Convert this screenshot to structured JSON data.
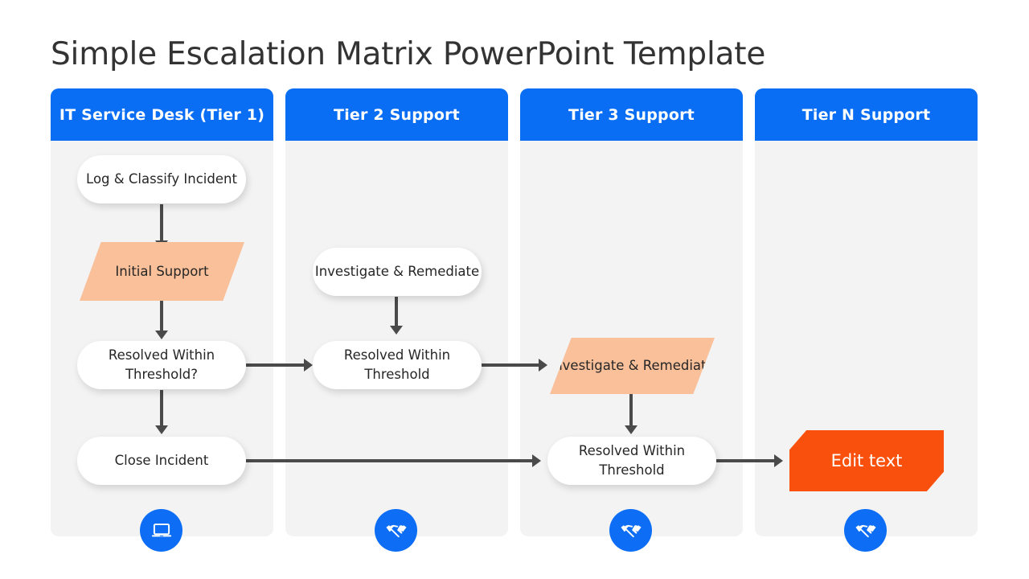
{
  "slide": {
    "title": "Simple Escalation Matrix PowerPoint Template",
    "background": "#ffffff"
  },
  "colors": {
    "header_blue": "#0a6ef5",
    "panel_gray": "#f3f3f3",
    "parallelogram_peach": "#f9c09a",
    "hexagon_orange": "#f9510d",
    "arrow_gray": "#4a4a4a",
    "node_white": "#ffffff",
    "text_dark": "#262626",
    "title_gray": "#333333"
  },
  "columns": [
    {
      "header": "IT Service Desk (Tier 1)",
      "icon": "laptop-icon",
      "nodes": [
        {
          "label": "Log & Classify Incident",
          "shape": "pill"
        },
        {
          "label": "Initial Support",
          "shape": "parallelogram"
        },
        {
          "label": "Resolved Within Threshold?",
          "shape": "pill"
        },
        {
          "label": "Close Incident",
          "shape": "pill"
        }
      ]
    },
    {
      "header": "Tier 2 Support",
      "icon": "handshake-icon",
      "nodes": [
        {
          "label": "Investigate & Remediate",
          "shape": "pill"
        },
        {
          "label": "Resolved Within Threshold",
          "shape": "pill"
        }
      ]
    },
    {
      "header": "Tier 3 Support",
      "icon": "handshake-icon",
      "nodes": [
        {
          "label": "Investigate & Remediate",
          "shape": "parallelogram"
        },
        {
          "label": "Resolved Within Threshold",
          "shape": "pill"
        }
      ]
    },
    {
      "header": "Tier N Support",
      "icon": "handshake-icon",
      "nodes": [
        {
          "label": "Edit text",
          "shape": "hexagon"
        }
      ]
    }
  ]
}
